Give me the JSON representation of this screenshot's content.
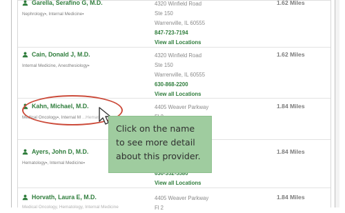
{
  "providers": [
    {
      "name": "Garella, Serafino G, M.D.",
      "specialties": [
        "Nephrology",
        "Internal Medicine"
      ],
      "address_lines": [
        "4320 Winfield Road",
        "Ste 150",
        "Warrenville, IL 60555"
      ],
      "phone": "847-723-7194",
      "locations_link": "View all Locations",
      "distance": "1.62 Miles"
    },
    {
      "name": "Cain, Donald J, M.D.",
      "specialties": [
        "Internal Medicine",
        "Anesthesiology"
      ],
      "address_lines": [
        "4320 Winfield Road",
        "Ste 150",
        "Warrenville, IL 60555"
      ],
      "phone": "630-868-2200",
      "locations_link": "View all Locations",
      "distance": "1.62 Miles"
    },
    {
      "name": "Kahn, Michael, M.D.",
      "specialties": [
        "Medical Oncology",
        "Internal M",
        "...Hematology"
      ],
      "address_lines": [
        "4405 Weaver Parkway",
        "Fl 2"
      ],
      "distance": "1.84 Miles"
    },
    {
      "name": "Ayers, John D, M.D.",
      "specialties": [
        "Hematology",
        "Internal Medicine"
      ],
      "phone": "630-352-5580",
      "locations_link": "View all Locations",
      "distance": "1.84 Miles"
    },
    {
      "name": "Horvath, Laura E, M.D.",
      "specialties": [
        "Medical Oncology",
        "Hematology",
        "Internal Medicine"
      ],
      "address_lines": [
        "4405 Weaver Parkway",
        "Fl 2"
      ],
      "distance": "1.84 Miles"
    }
  ],
  "callout": {
    "text": "Click on the name to see more detail about this provider."
  },
  "ui": {
    "accent": "#2f7d3c",
    "highlight_color": "#cc4b3a",
    "callout_bg": "#9fcc9f"
  }
}
